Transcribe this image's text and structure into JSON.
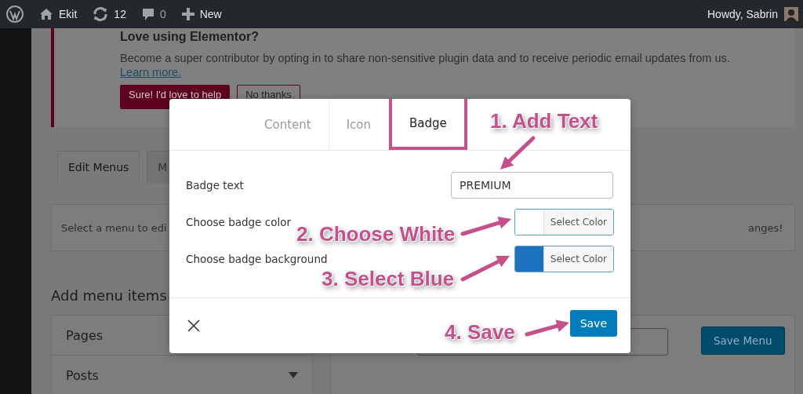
{
  "admin_bar": {
    "site": "Ekit",
    "updates": "12",
    "comments": "0",
    "new": "New",
    "greeting": "Howdy, Sabrin"
  },
  "notice": {
    "title": "Love using Elementor?",
    "text": "Become a super contributor by opting in to share non-sensitive plugin data and to receive periodic email updates from us.",
    "link": "Learn more.",
    "buttons": [
      "Sure! I'd love to help",
      "No thanks"
    ]
  },
  "menu_tabs": [
    {
      "label": "Edit Menus",
      "selected": true
    },
    {
      "label": "M",
      "selected": false
    }
  ],
  "menu_hint": {
    "left": "Select a menu to edi",
    "right": "anges!"
  },
  "add_menu_items": {
    "title": "Add menu items",
    "sections": [
      "Pages",
      "Posts"
    ]
  },
  "save_menu": "Save Menu",
  "modal": {
    "tabs": [
      {
        "label": "Content",
        "selected": false
      },
      {
        "label": "Icon",
        "selected": false
      },
      {
        "label": "Badge",
        "selected": true
      }
    ],
    "badge_text": {
      "label": "Badge text",
      "value": "PREMIUM"
    },
    "colors": [
      {
        "label": "Choose badge color",
        "color": "#ffffff",
        "button": "Select Color"
      },
      {
        "label": "Choose badge background",
        "color": "#1e73be",
        "button": "Select Color"
      }
    ],
    "save": "Save"
  },
  "annotations": [
    "1. Add Text",
    "2. Choose White",
    "3. Select Blue",
    "4. Save"
  ]
}
